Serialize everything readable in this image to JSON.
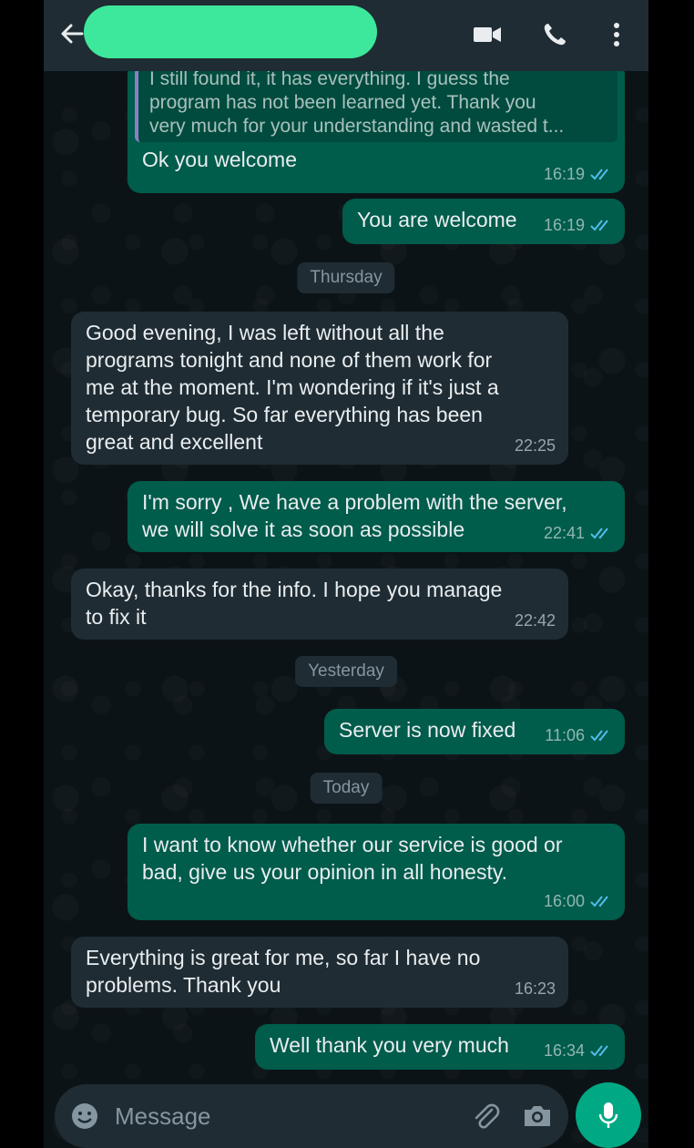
{
  "header": {
    "back_icon": "arrow-left-icon",
    "video_icon": "video-call-icon",
    "call_icon": "phone-icon",
    "menu_icon": "more-vert-icon"
  },
  "colors": {
    "header_bg": "#1f2c33",
    "chat_bg": "#0c1317",
    "outgoing_bubble": "#005c4b",
    "incoming_bubble": "#1f2c33",
    "read_ticks": "#53bdeb",
    "accent": "#00a884"
  },
  "messages": [
    {
      "direction": "out",
      "quote": "I still found it, it has everything. I guess the\nprogram has not been learned yet. Thank you\nvery much for your understanding and wasted t...",
      "text": "Ok you welcome",
      "time": "16:19",
      "status": "read"
    },
    {
      "direction": "out",
      "text": "You are welcome",
      "time": "16:19",
      "status": "read"
    },
    {
      "day": "Thursday"
    },
    {
      "direction": "in",
      "text": "Good evening, I was left without all the\nprograms tonight and none of them work for\nme at the moment. I'm wondering if it's just a\ntemporary bug. So far everything has been\ngreat and excellent",
      "time": "22:25"
    },
    {
      "direction": "out",
      "text": "I'm sorry , We have a problem with the server,\nwe will solve it as soon as possible",
      "time": "22:41",
      "status": "read"
    },
    {
      "direction": "in",
      "text": "Okay, thanks for the info. I hope you manage\nto fix it",
      "time": "22:42"
    },
    {
      "day": "Yesterday"
    },
    {
      "direction": "out",
      "text": "Server is now fixed",
      "time": "11:06",
      "status": "read"
    },
    {
      "day": "Today"
    },
    {
      "direction": "out",
      "text": "I want to know whether our service is good or\nbad, give us your opinion in all honesty.",
      "time": "16:00",
      "status": "read"
    },
    {
      "direction": "in",
      "text": "Everything is great for me, so far I have no\nproblems. Thank you",
      "time": "16:23"
    },
    {
      "direction": "out",
      "text": "Well thank you very much",
      "time": "16:34",
      "status": "read"
    }
  ],
  "input": {
    "placeholder": "Message",
    "emoji_icon": "emoji-icon",
    "attach_icon": "paperclip-icon",
    "camera_icon": "camera-icon",
    "mic_icon": "microphone-icon"
  }
}
